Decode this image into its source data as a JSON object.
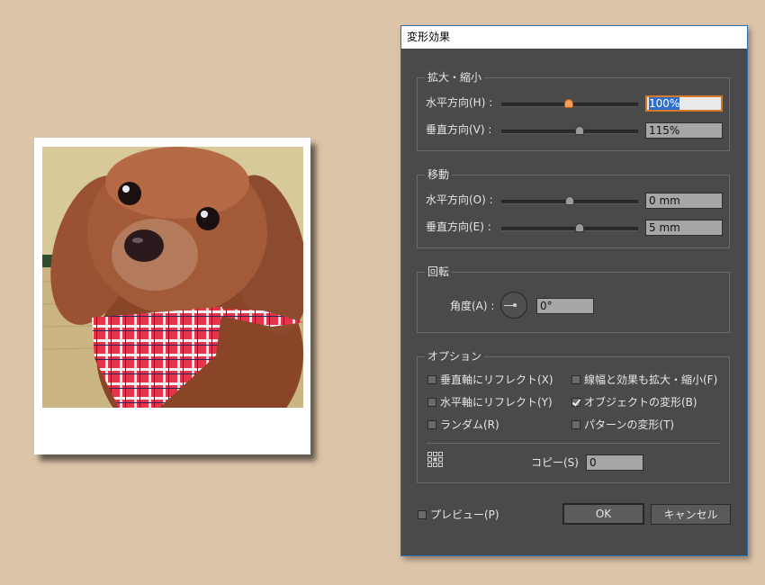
{
  "dialog": {
    "title": "変形効果",
    "scale": {
      "legend": "拡大・縮小",
      "horizontal_label": "水平方向(H) :",
      "horizontal_value": "100%",
      "vertical_label": "垂直方向(V) :",
      "vertical_value": "115%"
    },
    "move": {
      "legend": "移動",
      "horizontal_label": "水平方向(O) :",
      "horizontal_value": "0 mm",
      "vertical_label": "垂直方向(E) :",
      "vertical_value": "5 mm"
    },
    "rotate": {
      "legend": "回転",
      "angle_label": "角度(A) :",
      "angle_value": "0°"
    },
    "options": {
      "legend": "オプション",
      "reflect_x": {
        "label": "垂直軸にリフレクト(X)",
        "checked": false
      },
      "scale_strokes": {
        "label": "線幅と効果も拡大・縮小(F)",
        "checked": false
      },
      "reflect_y": {
        "label": "水平軸にリフレクト(Y)",
        "checked": false
      },
      "transform_objects": {
        "label": "オブジェクトの変形(B)",
        "checked": true
      },
      "random": {
        "label": "ランダム(R)",
        "checked": false
      },
      "transform_patterns": {
        "label": "パターンの変形(T)",
        "checked": false
      },
      "copies_label": "コピー(S)",
      "copies_value": "0"
    },
    "preview": {
      "label": "プレビュー(P)",
      "checked": false
    },
    "ok_label": "OK",
    "cancel_label": "キャンセル"
  },
  "colors": {
    "background": "#dcc4a9",
    "dialog_bg": "#4a4a4a",
    "accent": "#d47a27",
    "selection": "#2e6ed0"
  },
  "icons": {
    "reference_point": "reference-point-icon",
    "angle_dial": "angle-dial-icon"
  }
}
